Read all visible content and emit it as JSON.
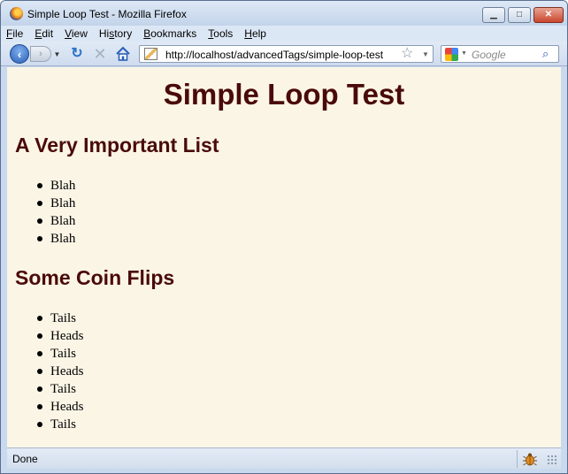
{
  "window": {
    "title": "Simple Loop Test - Mozilla Firefox",
    "controls": {
      "minimize": "▁",
      "maximize": "□",
      "close": "✕"
    }
  },
  "menubar": {
    "items": [
      {
        "accel": "F",
        "rest": "ile"
      },
      {
        "accel": "E",
        "rest": "dit"
      },
      {
        "accel": "V",
        "rest": "iew"
      },
      {
        "pre": "Hi",
        "accel": "s",
        "rest": "tory"
      },
      {
        "accel": "B",
        "rest": "ookmarks"
      },
      {
        "accel": "T",
        "rest": "ools"
      },
      {
        "accel": "H",
        "rest": "elp"
      }
    ]
  },
  "navbar": {
    "url": "http://localhost/advancedTags/simple-loop-test",
    "search_placeholder": "Google",
    "icons": [
      "back-icon",
      "forward-icon",
      "reload-icon",
      "stop-icon",
      "home-icon",
      "bookmark-star-icon",
      "google-icon",
      "search-icon"
    ]
  },
  "page": {
    "heading": "Simple Loop Test",
    "sections": [
      {
        "title": "A Very Important List",
        "items": [
          "Blah",
          "Blah",
          "Blah",
          "Blah"
        ]
      },
      {
        "title": "Some Coin Flips",
        "items": [
          "Tails",
          "Heads",
          "Tails",
          "Heads",
          "Tails",
          "Heads",
          "Tails"
        ]
      }
    ]
  },
  "status": {
    "text": "Done"
  },
  "colors": {
    "heading": "#4a0a0a",
    "page_background": "#fbf5e6",
    "chrome": "#c9d9ee"
  }
}
